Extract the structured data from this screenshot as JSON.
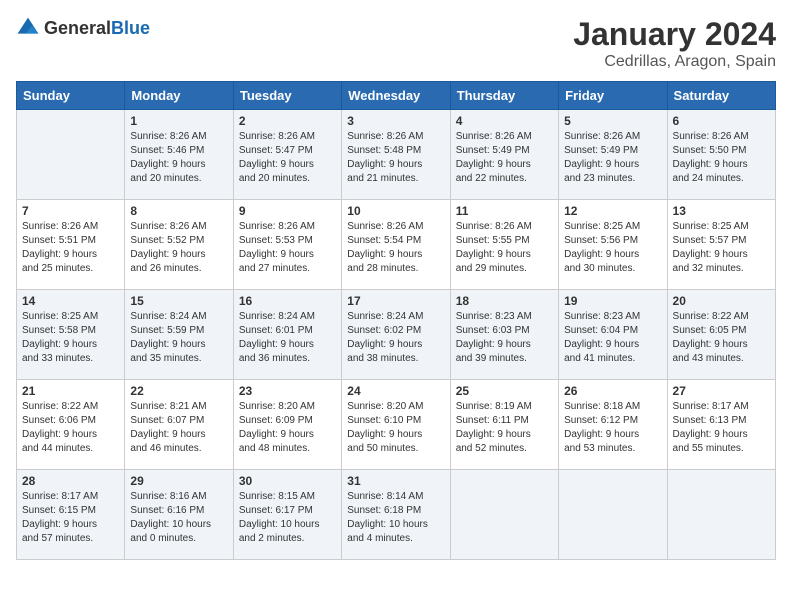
{
  "header": {
    "logo_general": "General",
    "logo_blue": "Blue",
    "month": "January 2024",
    "location": "Cedrillas, Aragon, Spain"
  },
  "days_of_week": [
    "Sunday",
    "Monday",
    "Tuesday",
    "Wednesday",
    "Thursday",
    "Friday",
    "Saturday"
  ],
  "weeks": [
    [
      {
        "day": "",
        "content": ""
      },
      {
        "day": "1",
        "content": "Sunrise: 8:26 AM\nSunset: 5:46 PM\nDaylight: 9 hours\nand 20 minutes."
      },
      {
        "day": "2",
        "content": "Sunrise: 8:26 AM\nSunset: 5:47 PM\nDaylight: 9 hours\nand 20 minutes."
      },
      {
        "day": "3",
        "content": "Sunrise: 8:26 AM\nSunset: 5:48 PM\nDaylight: 9 hours\nand 21 minutes."
      },
      {
        "day": "4",
        "content": "Sunrise: 8:26 AM\nSunset: 5:49 PM\nDaylight: 9 hours\nand 22 minutes."
      },
      {
        "day": "5",
        "content": "Sunrise: 8:26 AM\nSunset: 5:49 PM\nDaylight: 9 hours\nand 23 minutes."
      },
      {
        "day": "6",
        "content": "Sunrise: 8:26 AM\nSunset: 5:50 PM\nDaylight: 9 hours\nand 24 minutes."
      }
    ],
    [
      {
        "day": "7",
        "content": "Sunrise: 8:26 AM\nSunset: 5:51 PM\nDaylight: 9 hours\nand 25 minutes."
      },
      {
        "day": "8",
        "content": "Sunrise: 8:26 AM\nSunset: 5:52 PM\nDaylight: 9 hours\nand 26 minutes."
      },
      {
        "day": "9",
        "content": "Sunrise: 8:26 AM\nSunset: 5:53 PM\nDaylight: 9 hours\nand 27 minutes."
      },
      {
        "day": "10",
        "content": "Sunrise: 8:26 AM\nSunset: 5:54 PM\nDaylight: 9 hours\nand 28 minutes."
      },
      {
        "day": "11",
        "content": "Sunrise: 8:26 AM\nSunset: 5:55 PM\nDaylight: 9 hours\nand 29 minutes."
      },
      {
        "day": "12",
        "content": "Sunrise: 8:25 AM\nSunset: 5:56 PM\nDaylight: 9 hours\nand 30 minutes."
      },
      {
        "day": "13",
        "content": "Sunrise: 8:25 AM\nSunset: 5:57 PM\nDaylight: 9 hours\nand 32 minutes."
      }
    ],
    [
      {
        "day": "14",
        "content": "Sunrise: 8:25 AM\nSunset: 5:58 PM\nDaylight: 9 hours\nand 33 minutes."
      },
      {
        "day": "15",
        "content": "Sunrise: 8:24 AM\nSunset: 5:59 PM\nDaylight: 9 hours\nand 35 minutes."
      },
      {
        "day": "16",
        "content": "Sunrise: 8:24 AM\nSunset: 6:01 PM\nDaylight: 9 hours\nand 36 minutes."
      },
      {
        "day": "17",
        "content": "Sunrise: 8:24 AM\nSunset: 6:02 PM\nDaylight: 9 hours\nand 38 minutes."
      },
      {
        "day": "18",
        "content": "Sunrise: 8:23 AM\nSunset: 6:03 PM\nDaylight: 9 hours\nand 39 minutes."
      },
      {
        "day": "19",
        "content": "Sunrise: 8:23 AM\nSunset: 6:04 PM\nDaylight: 9 hours\nand 41 minutes."
      },
      {
        "day": "20",
        "content": "Sunrise: 8:22 AM\nSunset: 6:05 PM\nDaylight: 9 hours\nand 43 minutes."
      }
    ],
    [
      {
        "day": "21",
        "content": "Sunrise: 8:22 AM\nSunset: 6:06 PM\nDaylight: 9 hours\nand 44 minutes."
      },
      {
        "day": "22",
        "content": "Sunrise: 8:21 AM\nSunset: 6:07 PM\nDaylight: 9 hours\nand 46 minutes."
      },
      {
        "day": "23",
        "content": "Sunrise: 8:20 AM\nSunset: 6:09 PM\nDaylight: 9 hours\nand 48 minutes."
      },
      {
        "day": "24",
        "content": "Sunrise: 8:20 AM\nSunset: 6:10 PM\nDaylight: 9 hours\nand 50 minutes."
      },
      {
        "day": "25",
        "content": "Sunrise: 8:19 AM\nSunset: 6:11 PM\nDaylight: 9 hours\nand 52 minutes."
      },
      {
        "day": "26",
        "content": "Sunrise: 8:18 AM\nSunset: 6:12 PM\nDaylight: 9 hours\nand 53 minutes."
      },
      {
        "day": "27",
        "content": "Sunrise: 8:17 AM\nSunset: 6:13 PM\nDaylight: 9 hours\nand 55 minutes."
      }
    ],
    [
      {
        "day": "28",
        "content": "Sunrise: 8:17 AM\nSunset: 6:15 PM\nDaylight: 9 hours\nand 57 minutes."
      },
      {
        "day": "29",
        "content": "Sunrise: 8:16 AM\nSunset: 6:16 PM\nDaylight: 10 hours\nand 0 minutes."
      },
      {
        "day": "30",
        "content": "Sunrise: 8:15 AM\nSunset: 6:17 PM\nDaylight: 10 hours\nand 2 minutes."
      },
      {
        "day": "31",
        "content": "Sunrise: 8:14 AM\nSunset: 6:18 PM\nDaylight: 10 hours\nand 4 minutes."
      },
      {
        "day": "",
        "content": ""
      },
      {
        "day": "",
        "content": ""
      },
      {
        "day": "",
        "content": ""
      }
    ]
  ]
}
